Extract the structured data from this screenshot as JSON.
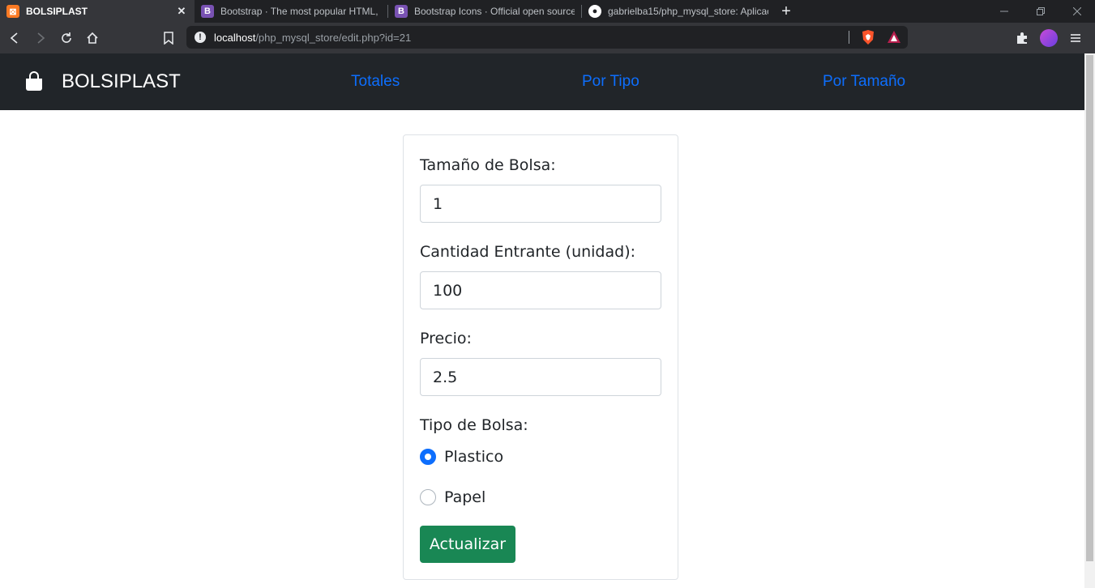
{
  "browser": {
    "tabs": [
      {
        "title": "BOLSIPLAST",
        "favicon": "xampp-icon",
        "active": true
      },
      {
        "title": "Bootstrap · The most popular HTML, C",
        "favicon": "bootstrap-icon",
        "active": false
      },
      {
        "title": "Bootstrap Icons · Official open source",
        "favicon": "bootstrap-icon",
        "active": false
      },
      {
        "title": "gabrielba15/php_mysql_store: Aplicac",
        "favicon": "github-icon",
        "active": false
      }
    ],
    "url_host": "localhost",
    "url_path": "/php_mysql_store/edit.php?id=21"
  },
  "navbar": {
    "brand": "BOLSIPLAST",
    "links": [
      "Totales",
      "Por Tipo",
      "Por Tamaño"
    ]
  },
  "form": {
    "size_label": "Tamaño de Bolsa:",
    "size_value": "1",
    "qty_label": "Cantidad Entrante (unidad):",
    "qty_value": "100",
    "price_label": "Precio:",
    "price_value": "2.5",
    "type_label": "Tipo de Bolsa:",
    "type_options": [
      {
        "label": "Plastico",
        "checked": true
      },
      {
        "label": "Papel",
        "checked": false
      }
    ],
    "submit_label": "Actualizar"
  },
  "colors": {
    "navbar_bg": "#212529",
    "link": "#0d6efd",
    "button": "#198754",
    "radio_checked": "#0d6efd"
  }
}
